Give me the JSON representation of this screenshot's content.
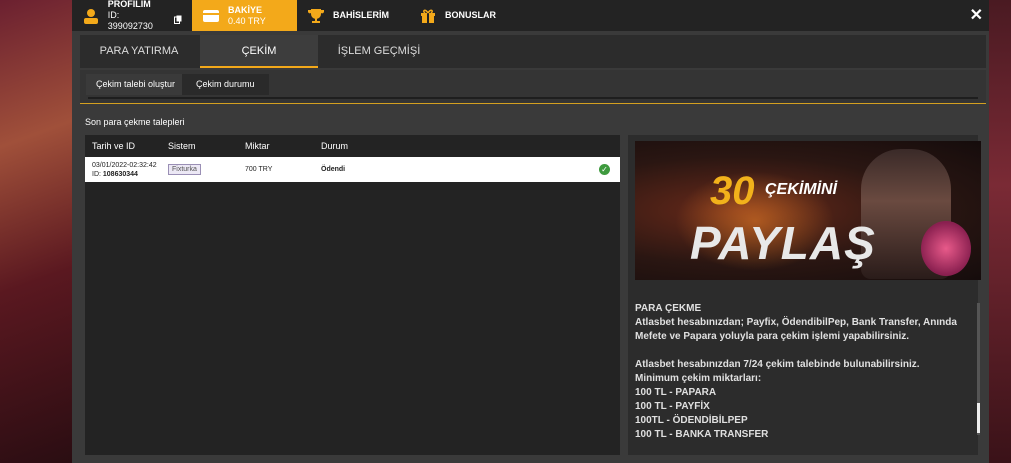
{
  "topbar": {
    "profile": {
      "label": "PROFİLİM",
      "id_text": "ID: 399092730"
    },
    "balance": {
      "label": "BAKİYE",
      "value": "0.40 TRY"
    },
    "bets": {
      "label": "BAHİSLERİM"
    },
    "bonuses": {
      "label": "BONUSLAR"
    },
    "close": "✕"
  },
  "tabs": [
    {
      "label": "PARA YATIRMA"
    },
    {
      "label": "ÇEKİM"
    },
    {
      "label": "İŞLEM GEÇMİŞİ"
    }
  ],
  "subtabs": [
    {
      "label": "Çekim talebi oluştur"
    },
    {
      "label": "Çekim durumu"
    }
  ],
  "withdrawals": {
    "title": "Son para çekme talepleri",
    "columns": [
      "Tarih ve ID",
      "Sistem",
      "Miktar",
      "Durum"
    ],
    "rows": [
      {
        "date": "03/01/2022-02:32:42",
        "id_prefix": "ID: ",
        "id": "108630344",
        "system": "Fixturka",
        "amount": "700 TRY",
        "status": "Ödendi"
      }
    ]
  },
  "banner": {
    "number": "30",
    "word1": "ÇEKİMİNİ",
    "word2": "PAYLAŞ"
  },
  "info": {
    "lines": [
      "PARA ÇEKME",
      "Atlasbet hesabınızdan; Payfix, ÖdendibilPep, Bank Transfer, Anında Mefete ve Papara yoluyla para çekim işlemi yapabilirsiniz.",
      "",
      "Atlasbet hesabınızdan 7/24 çekim talebinde bulunabilirsiniz.",
      "Minimum çekim miktarları:",
      "100 TL - PAPARA",
      "100 TL - PAYFİX",
      "100TL - ÖDENDİBİLPEP",
      "100 TL - BANKA TRANSFER"
    ]
  },
  "colors": {
    "accent": "#f3a91a",
    "topbar": "#232323",
    "panel": "#3a3a3a",
    "success": "#3e9a3e"
  }
}
